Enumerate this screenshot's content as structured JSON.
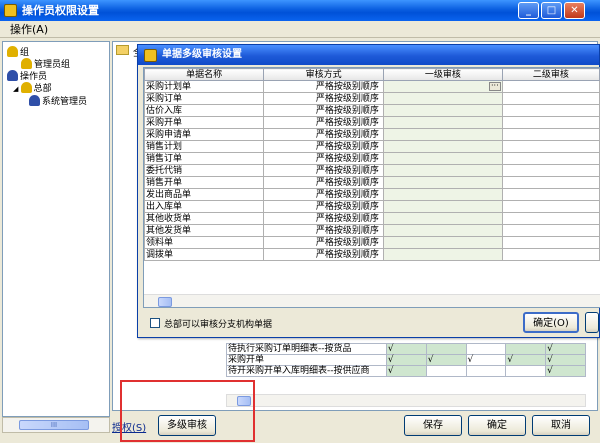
{
  "window": {
    "title": "操作员权限设置",
    "min": "_",
    "max": "□",
    "close": "✕"
  },
  "menu": {
    "operate": "操作(A)"
  },
  "tree": {
    "group": "组",
    "admin_group": "管理员组",
    "operators": "操作员",
    "hq": "总部",
    "sysadmin": "系统管理员"
  },
  "right": {
    "folder_label": "全"
  },
  "bg_table": {
    "rows": [
      {
        "name": "待执行采购订单明细表--按货品",
        "cells": [
          "√",
          "",
          "",
          "",
          "√"
        ]
      },
      {
        "name": "采购开单",
        "cells": [
          "√",
          "√",
          "√",
          "√",
          "√"
        ]
      },
      {
        "name": "待开采购开单入库明细表--按供应商",
        "cells": [
          "√",
          "",
          "",
          "",
          "√"
        ]
      }
    ]
  },
  "dialog": {
    "title": "单据多级审核设置",
    "headers": [
      "单据名称",
      "审核方式",
      "一级审核",
      "二级审核"
    ],
    "rows": [
      {
        "name": "采购计划单",
        "method": "严格按级别顺序"
      },
      {
        "name": "采购订单",
        "method": "严格按级别顺序"
      },
      {
        "name": "估价入库",
        "method": "严格按级别顺序"
      },
      {
        "name": "采购开单",
        "method": "严格按级别顺序"
      },
      {
        "name": "采购申请单",
        "method": "严格按级别顺序"
      },
      {
        "name": "销售计划",
        "method": "严格按级别顺序"
      },
      {
        "name": "销售订单",
        "method": "严格按级别顺序"
      },
      {
        "name": "委托代销",
        "method": "严格按级别顺序"
      },
      {
        "name": "销售开单",
        "method": "严格按级别顺序"
      },
      {
        "name": "发出商品单",
        "method": "严格按级别顺序"
      },
      {
        "name": "出入库单",
        "method": "严格按级别顺序"
      },
      {
        "name": "其他收货单",
        "method": "严格按级别顺序"
      },
      {
        "name": "其他发货单",
        "method": "严格按级别顺序"
      },
      {
        "name": "领料单",
        "method": "严格按级别顺序"
      },
      {
        "name": "调拨单",
        "method": "严格按级别顺序"
      }
    ],
    "ellipsis": "···",
    "checkbox_label": "总部可以审核分支机构单据",
    "ok": "确定(O)"
  },
  "bottom": {
    "auth_link": "授权(S)",
    "multi_audit": "多级审核",
    "save": "保存",
    "ok": "确定",
    "cancel": "取消"
  },
  "hscroll": {
    "grip": "III"
  }
}
